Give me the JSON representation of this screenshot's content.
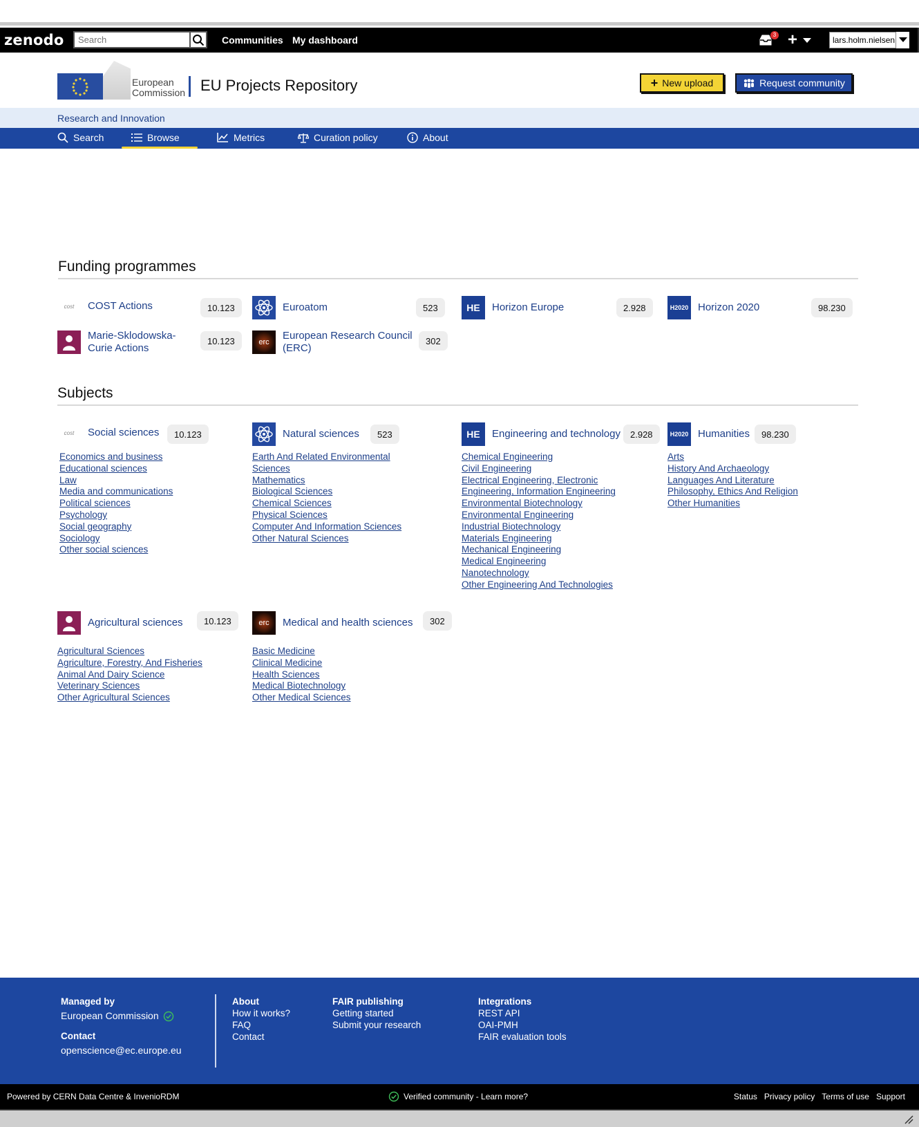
{
  "topbar": {
    "logo": "zenodo",
    "search_placeholder": "Search",
    "nav": [
      "Communities",
      "My dashboard"
    ],
    "inbox_count": "3",
    "user": "lars.holm.nielsen"
  },
  "header": {
    "logo_text_line1": "European",
    "logo_text_line2": "Commission",
    "title": "EU Projects Repository",
    "new_upload": "New upload",
    "request_community": "Request community"
  },
  "subbar": {
    "label": "Research and Innovation"
  },
  "nav": {
    "items": [
      "Search",
      "Browse",
      "Metrics",
      "Curation policy",
      "About"
    ],
    "active": "Browse"
  },
  "funding": {
    "title": "Funding programmes",
    "items": [
      {
        "label": "COST Actions",
        "count": "10.123",
        "icon": "cost-logo-icon"
      },
      {
        "label": "Euroatom",
        "count": "523",
        "icon": "atom-icon"
      },
      {
        "label": "Horizon Europe",
        "count": "2.928",
        "icon_text": "HE"
      },
      {
        "label": "Horizon 2020",
        "count": "98.230",
        "icon_text": "H2020"
      },
      {
        "label_line1": "Marie-Sklodowska-",
        "label_line2": "Curie Actions",
        "count": "10.123",
        "icon": "msca-icon"
      },
      {
        "label_line1": "European Research Council",
        "label_line2": "(ERC)",
        "count": "302",
        "icon_text": "erc"
      }
    ]
  },
  "subjects": {
    "title": "Subjects",
    "groups": [
      {
        "label": "Social sciences",
        "count": "10.123",
        "links": [
          "Economics and business",
          "Educational sciences",
          "Law",
          "Media and communications",
          "Political sciences",
          "Psychology",
          "Social geography",
          "Sociology",
          "Other social sciences"
        ]
      },
      {
        "label": "Natural sciences",
        "count": "523",
        "links": [
          "Earth And Related Environmental ",
          "Sciences",
          "Mathematics",
          "Biological Sciences",
          "Chemical Sciences",
          "Physical Sciences",
          "Computer And Information Sciences",
          "Other Natural Sciences"
        ]
      },
      {
        "label": "Engineering and technology",
        "count": "2.928",
        "icon_text": "HE",
        "links": [
          "Chemical Engineering",
          "Civil Engineering",
          "Electrical Engineering, Electronic ",
          "Engineering, Information Engineering",
          "Environmental Biotechnology",
          "Environmental Engineering",
          "Industrial Biotechnology",
          "Materials Engineering",
          "Mechanical Engineering",
          "Medical Engineering",
          "Nanotechnology",
          "Other Engineering And Technologies"
        ]
      },
      {
        "label": "Humanities",
        "count": "98.230",
        "icon_text": "H2020",
        "links": [
          "Arts",
          "History And Archaeology",
          "Languages And Literature",
          "Philosophy, Ethics And Religion",
          "Other Humanities"
        ]
      },
      {
        "label": "Agricultural sciences",
        "count": "10.123",
        "links": [
          "Agricultural Sciences",
          "Agriculture, Forestry, And Fisheries",
          "Animal And Dairy Science",
          "Veterinary Sciences",
          "Other Agricultural Sciences"
        ]
      },
      {
        "label": "Medical and health sciences",
        "count": "302",
        "icon_text": "erc",
        "links": [
          "Basic Medicine",
          "Clinical Medicine",
          "Health Sciences",
          "Medical Biotechnology",
          "Other Medical Sciences"
        ]
      }
    ]
  },
  "footer": {
    "managed_by_h": "Managed by",
    "managed_by": "European Commission",
    "contact_h": "Contact",
    "contact": "openscience@ec.europe.eu",
    "about": {
      "h": "About",
      "links": [
        "How it works?",
        "FAQ",
        "Contact"
      ]
    },
    "fair": {
      "h": "FAIR publishing",
      "links": [
        "Getting started",
        "Submit your research"
      ]
    },
    "integrations": {
      "h": "Integrations",
      "links": [
        "REST API",
        "OAI-PMH",
        "FAIR evaluation tools"
      ]
    }
  },
  "bottombar": {
    "powered": "Powered by CERN Data Centre & InvenioRDM",
    "verified": "Verified community - Learn more?",
    "links": [
      "Status",
      "Privacy policy",
      "Terms of use",
      "Support"
    ]
  },
  "colors": {
    "brand_blue": "#1d47a0",
    "accent_yellow": "#f3d435",
    "link_blue": "#1d3f89"
  }
}
